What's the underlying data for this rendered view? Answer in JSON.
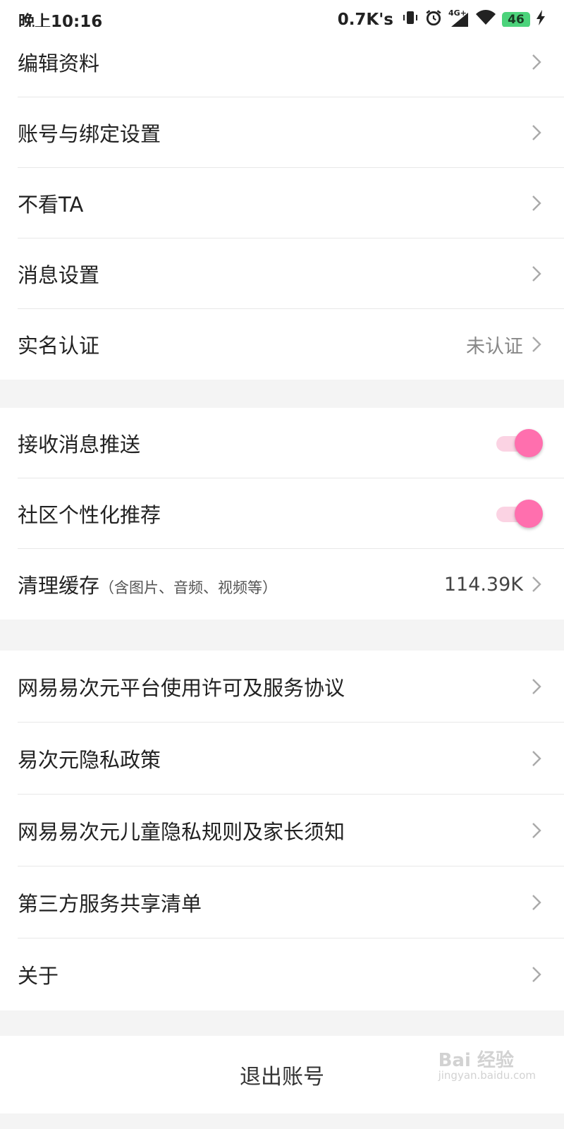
{
  "status_bar": {
    "time": "晚上10:16",
    "net_speed": "0.7K's",
    "network": "4G+",
    "battery": "46"
  },
  "account_group": [
    {
      "label": "编辑资料",
      "value": ""
    },
    {
      "label": "账号与绑定设置",
      "value": ""
    },
    {
      "label": "不看TA",
      "value": ""
    },
    {
      "label": "消息设置",
      "value": ""
    },
    {
      "label": "实名认证",
      "value": "未认证"
    }
  ],
  "settings_group": {
    "push": {
      "label": "接收消息推送",
      "enabled": true
    },
    "personalized": {
      "label": "社区个性化推荐",
      "enabled": true
    },
    "cache": {
      "label": "清理缓存",
      "note": "（含图片、音频、视频等）",
      "value": "114.39K"
    }
  },
  "legal_group": [
    {
      "label": "网易易次元平台使用许可及服务协议"
    },
    {
      "label": "易次元隐私政策"
    },
    {
      "label": "网易易次元儿童隐私规则及家长须知"
    },
    {
      "label": "第三方服务共享清单"
    },
    {
      "label": "关于"
    }
  ],
  "logout_label": "退出账号",
  "watermark": {
    "text": "Bai 经验",
    "sub": "jingyan.baidu.com"
  },
  "colors": {
    "accent": "#ff6fae",
    "track": "#fbd3e3",
    "background": "#f4f4f4"
  }
}
